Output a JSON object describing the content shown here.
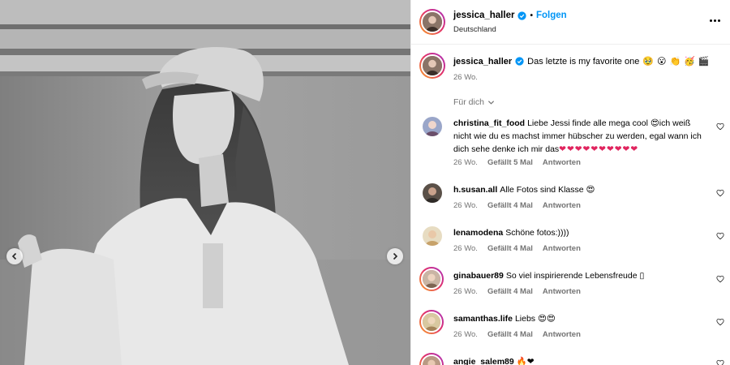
{
  "post": {
    "username": "jessica_haller",
    "follow_label": "Folgen",
    "separator": "•",
    "location": "Deutschland",
    "caption_text": "Das letzte is my favorite one",
    "caption_emojis": [
      "🥹",
      "😮",
      "👏",
      "🥳",
      "🎬"
    ],
    "caption_time": "26 Wo."
  },
  "sort_label": "Für dich",
  "comments": [
    {
      "username": "christina_fit_food",
      "text": "Liebe Jessi finde alle mega cool 😍ich weiß nicht wie du es machst immer hübscher zu werden, egal wann ich dich sehe denke ich mir das",
      "hearts": "❤❤❤❤❤❤❤❤❤❤",
      "time": "26 Wo.",
      "likes": "Gefällt 5 Mal",
      "reply": "Antworten"
    },
    {
      "username": "h.susan.all",
      "text": "Alle Fotos sind Klasse 😍",
      "time": "26 Wo.",
      "likes": "Gefällt 4 Mal",
      "reply": "Antworten"
    },
    {
      "username": "lenamodena",
      "text": "Schöne fotos:))))",
      "time": "26 Wo.",
      "likes": "Gefällt 4 Mal",
      "reply": "Antworten"
    },
    {
      "username": "ginabauer89",
      "text": "So viel inspirierende Lebensfreude ▯",
      "time": "26 Wo.",
      "likes": "Gefällt 4 Mal",
      "reply": "Antworten"
    },
    {
      "username": "samanthas.life",
      "text": "Liebs 😍😍",
      "time": "26 Wo.",
      "likes": "Gefällt 4 Mal",
      "reply": "Antworten"
    },
    {
      "username": "angie_salem89",
      "text": "🔥❤",
      "time": "",
      "likes": "",
      "reply": ""
    }
  ],
  "colors": {
    "accent": "#0095f6",
    "meta": "#737373",
    "like_heart": "#e0245e"
  },
  "icons": {
    "verified": "verified-badge-icon",
    "more": "more-options-icon",
    "prev": "chevron-left-icon",
    "next": "chevron-right-icon",
    "sort": "chevron-down-icon",
    "like": "heart-outline-icon"
  }
}
